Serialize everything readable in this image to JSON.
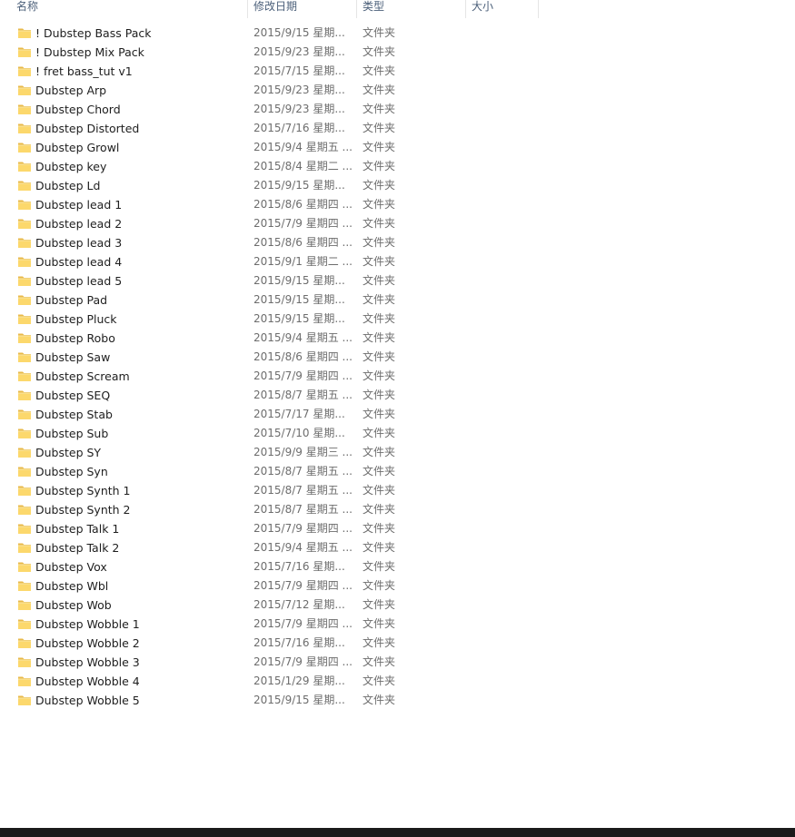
{
  "columns": {
    "name": "名称",
    "date": "修改日期",
    "type": "类型",
    "size": "大小"
  },
  "folder_icon": "folder-icon",
  "files": [
    {
      "name": "! Dubstep Bass Pack",
      "date": "2015/9/15 星期...",
      "type": "文件夹"
    },
    {
      "name": "! Dubstep Mix Pack",
      "date": "2015/9/23 星期...",
      "type": "文件夹"
    },
    {
      "name": "! fret bass_tut v1",
      "date": "2015/7/15 星期...",
      "type": "文件夹"
    },
    {
      "name": "Dubstep Arp",
      "date": "2015/9/23 星期...",
      "type": "文件夹"
    },
    {
      "name": "Dubstep Chord",
      "date": "2015/9/23 星期...",
      "type": "文件夹"
    },
    {
      "name": "Dubstep Distorted",
      "date": "2015/7/16 星期...",
      "type": "文件夹"
    },
    {
      "name": "Dubstep Growl",
      "date": "2015/9/4 星期五 ...",
      "type": "文件夹"
    },
    {
      "name": "Dubstep key",
      "date": "2015/8/4 星期二 ...",
      "type": "文件夹"
    },
    {
      "name": "Dubstep Ld",
      "date": "2015/9/15 星期...",
      "type": "文件夹"
    },
    {
      "name": "Dubstep lead 1",
      "date": "2015/8/6 星期四 ...",
      "type": "文件夹"
    },
    {
      "name": "Dubstep lead 2",
      "date": "2015/7/9 星期四 ...",
      "type": "文件夹"
    },
    {
      "name": "Dubstep lead 3",
      "date": "2015/8/6 星期四 ...",
      "type": "文件夹"
    },
    {
      "name": "Dubstep lead 4",
      "date": "2015/9/1 星期二 ...",
      "type": "文件夹"
    },
    {
      "name": "Dubstep lead 5",
      "date": "2015/9/15 星期...",
      "type": "文件夹"
    },
    {
      "name": "Dubstep Pad",
      "date": "2015/9/15 星期...",
      "type": "文件夹"
    },
    {
      "name": "Dubstep Pluck",
      "date": "2015/9/15 星期...",
      "type": "文件夹"
    },
    {
      "name": "Dubstep Robo",
      "date": "2015/9/4 星期五 ...",
      "type": "文件夹"
    },
    {
      "name": "Dubstep Saw",
      "date": "2015/8/6 星期四 ...",
      "type": "文件夹"
    },
    {
      "name": "Dubstep Scream",
      "date": "2015/7/9 星期四 ...",
      "type": "文件夹"
    },
    {
      "name": "Dubstep SEQ",
      "date": "2015/8/7 星期五 ...",
      "type": "文件夹"
    },
    {
      "name": "Dubstep Stab",
      "date": "2015/7/17 星期...",
      "type": "文件夹"
    },
    {
      "name": "Dubstep Sub",
      "date": "2015/7/10 星期...",
      "type": "文件夹"
    },
    {
      "name": "Dubstep SY",
      "date": "2015/9/9 星期三 ...",
      "type": "文件夹"
    },
    {
      "name": "Dubstep Syn",
      "date": "2015/8/7 星期五 ...",
      "type": "文件夹"
    },
    {
      "name": "Dubstep Synth 1",
      "date": "2015/8/7 星期五 ...",
      "type": "文件夹"
    },
    {
      "name": "Dubstep Synth 2",
      "date": "2015/8/7 星期五 ...",
      "type": "文件夹"
    },
    {
      "name": "Dubstep Talk 1",
      "date": "2015/7/9 星期四 ...",
      "type": "文件夹"
    },
    {
      "name": "Dubstep Talk 2",
      "date": "2015/9/4 星期五 ...",
      "type": "文件夹"
    },
    {
      "name": "Dubstep Vox",
      "date": "2015/7/16 星期...",
      "type": "文件夹"
    },
    {
      "name": "Dubstep Wbl",
      "date": "2015/7/9 星期四 ...",
      "type": "文件夹"
    },
    {
      "name": "Dubstep Wob",
      "date": "2015/7/12 星期...",
      "type": "文件夹"
    },
    {
      "name": "Dubstep Wobble 1",
      "date": "2015/7/9 星期四 ...",
      "type": "文件夹"
    },
    {
      "name": "Dubstep Wobble 2",
      "date": "2015/7/16 星期...",
      "type": "文件夹"
    },
    {
      "name": "Dubstep Wobble 3",
      "date": "2015/7/9 星期四 ...",
      "type": "文件夹"
    },
    {
      "name": "Dubstep Wobble 4",
      "date": "2015/1/29 星期...",
      "type": "文件夹"
    },
    {
      "name": "Dubstep Wobble 5",
      "date": "2015/9/15 星期...",
      "type": "文件夹"
    }
  ]
}
